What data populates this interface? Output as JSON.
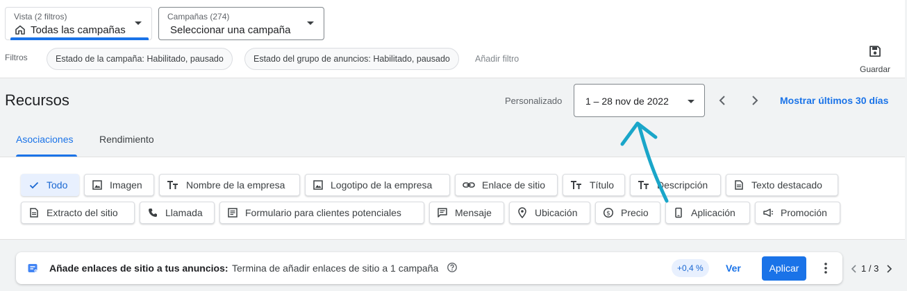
{
  "view_selector": {
    "label": "Vista (2 filtros)",
    "value": "Todas las campañas"
  },
  "campaign_selector": {
    "label": "Campañas (274)",
    "value": "Seleccionar una campaña"
  },
  "filters": {
    "label": "Filtros",
    "chips": [
      "Estado de la campaña: Habilitado, pausado",
      "Estado del grupo de anuncios: Habilitado, pausado"
    ],
    "add_label": "Añadir filtro"
  },
  "save_label": "Guardar",
  "page_title": "Recursos",
  "date_range": {
    "label": "Personalizado",
    "value": "1 – 28 nov de 2022",
    "quick_link": "Mostrar últimos 30 días"
  },
  "tabs": [
    "Asociaciones",
    "Rendimiento"
  ],
  "active_tab": "Asociaciones",
  "asset_types": {
    "row1": [
      "Todo",
      "Imagen",
      "Nombre de la empresa",
      "Logotipo de la empresa",
      "Enlace de sitio",
      "Título",
      "Descripción",
      "Texto destacado"
    ],
    "row2": [
      "Extracto del sitio",
      "Llamada",
      "Formulario para clientes potenciales",
      "Mensaje",
      "Ubicación",
      "Precio",
      "Aplicación",
      "Promoción"
    ],
    "selected": "Todo"
  },
  "recommendation": {
    "title": "Añade enlaces de sitio a tus anuncios:",
    "text": "Termina de añadir enlaces de sitio a 1 campaña",
    "badge": "+0,4 %",
    "view_label": "Ver",
    "apply_label": "Aplicar"
  },
  "pager": {
    "text": "1 / 3"
  },
  "colors": {
    "accent": "#1a73e8",
    "annotation": "#1aa6c9"
  }
}
